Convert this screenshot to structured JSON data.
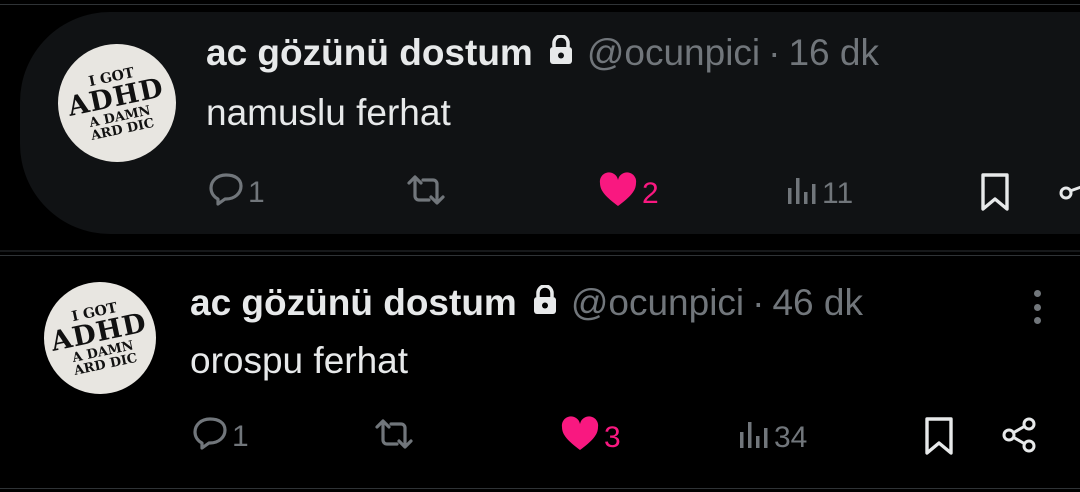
{
  "tweets": [
    {
      "avatar_lines": [
        "I GOT",
        "ADHD",
        "A DAMN",
        "ARD DIC"
      ],
      "name": "ac gözünü dostum",
      "handle": "@ocunpici",
      "separator": "·",
      "time": "16 dk",
      "text": "namuslu ferhat",
      "reply_count": "1",
      "retweet_count": "",
      "like_count": "2",
      "view_count": "11"
    },
    {
      "avatar_lines": [
        "I GOT",
        "ADHD",
        "A DAMN",
        "ARD DIC"
      ],
      "name": "ac gözünü dostum",
      "handle": "@ocunpici",
      "separator": "·",
      "time": "46 dk",
      "text": "orospu ferhat",
      "reply_count": "1",
      "retweet_count": "",
      "like_count": "3",
      "view_count": "34"
    }
  ],
  "icons": [
    "lock-icon",
    "reply-icon",
    "retweet-icon",
    "heart-filled-icon",
    "views-icon",
    "bookmark-icon",
    "share-icon",
    "more-icon"
  ],
  "colors": {
    "background": "#000000",
    "highlight": "#101214",
    "text": "#e7e9ea",
    "muted": "#71767b",
    "like": "#f91880",
    "divider": "#2f3336"
  }
}
